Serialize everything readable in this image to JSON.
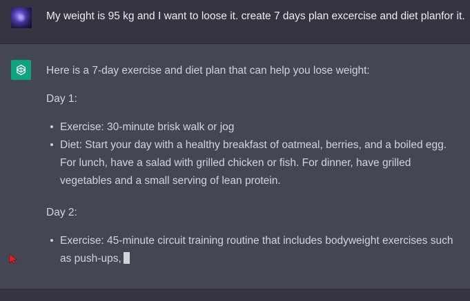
{
  "user_message": {
    "text": "My weight is 95 kg and I want to loose it. create 7 days plan excercise and diet planfor it."
  },
  "assistant_message": {
    "intro": "Here is a 7-day exercise and diet plan that can help you lose weight:",
    "days": [
      {
        "label": "Day 1:",
        "items": [
          "Exercise: 30-minute brisk walk or jog",
          "Diet: Start your day with a healthy breakfast of oatmeal, berries, and a boiled egg. For lunch, have a salad with grilled chicken or fish. For dinner, have grilled vegetables and a small serving of lean protein."
        ]
      },
      {
        "label": "Day 2:",
        "items": [
          "Exercise: 45-minute circuit training routine that includes bodyweight exercises such as push-ups,"
        ]
      }
    ]
  },
  "icons": {
    "user_avatar": "user-avatar",
    "assistant_logo": "openai-logo-icon",
    "cursor": "red-mouse-pointer-icon"
  },
  "colors": {
    "user_bg": "#343541",
    "assistant_bg": "#444654",
    "logo_bg": "#10a37f",
    "pointer": "#e0202a"
  }
}
